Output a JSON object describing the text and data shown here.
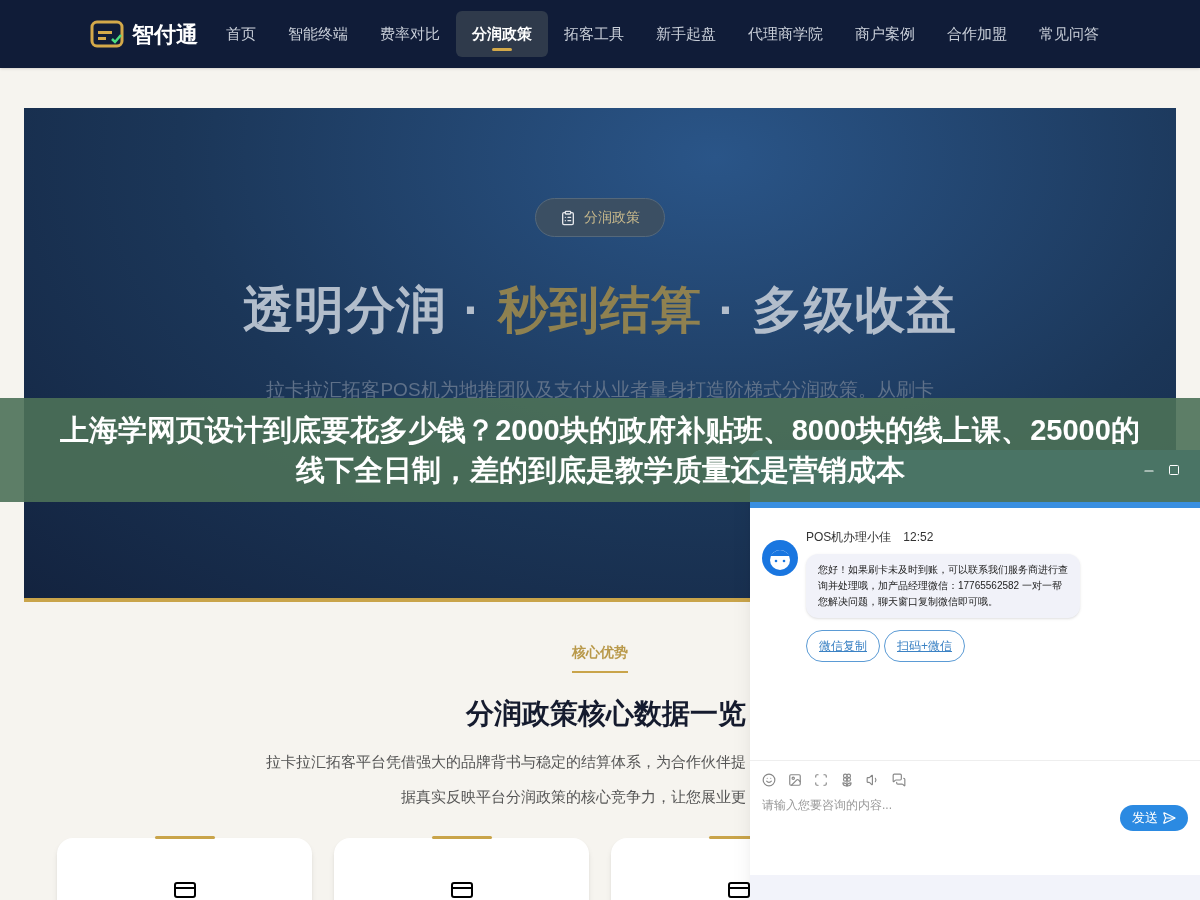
{
  "nav": {
    "brand": "智付通",
    "items": [
      {
        "label": "首页",
        "selected": false
      },
      {
        "label": "智能终端",
        "selected": false
      },
      {
        "label": "费率对比",
        "selected": false
      },
      {
        "label": "分润政策",
        "selected": true
      },
      {
        "label": "拓客工具",
        "selected": false
      },
      {
        "label": "新手起盘",
        "selected": false
      },
      {
        "label": "代理商学院",
        "selected": false
      },
      {
        "label": "商户案例",
        "selected": false
      },
      {
        "label": "合作加盟",
        "selected": false
      },
      {
        "label": "常见问答",
        "selected": false
      }
    ]
  },
  "hero": {
    "badge": "分润政策",
    "title_parts": [
      {
        "text": "透明分润",
        "highlight": false
      },
      {
        "text": "·",
        "highlight": false
      },
      {
        "text": "秒到结算",
        "highlight": true
      },
      {
        "text": "·",
        "highlight": false
      },
      {
        "text": "多级收益",
        "highlight": false
      }
    ],
    "description": "拉卡拉汇拓客POS机为地推团队及支付从业者量身打造阶梯式分润政策。从刷卡"
  },
  "section": {
    "label": "核心优势",
    "title": "分润政策核心数据一览",
    "description_lines": [
      "拉卡拉汇拓客平台凭借强大的品牌背书与稳定的结算体系，为合作伙伴提",
      "据真实反映平台分润政策的核心竞争力，让您展业更"
    ]
  },
  "caption_banner": {
    "text": "上海学网页设计到底要花多少钱？2000块的政府补贴班、8000块的线上课、25000的线下全日制，差的到底是教学质量还是营销成本"
  },
  "chat": {
    "agent": "POS机办理小佳",
    "time": "12:52",
    "message": "您好！如果刷卡未及时到账，可以联系我们服务商进行查询并处理哦，加产品经理微信：17765562582 一对一帮您解决问题，聊天窗口复制微信即可哦。",
    "actions": [
      "微信复制",
      "扫码+微信"
    ],
    "input": {
      "placeholder": "请输入您要咨询的内容..."
    },
    "send": "发送"
  }
}
